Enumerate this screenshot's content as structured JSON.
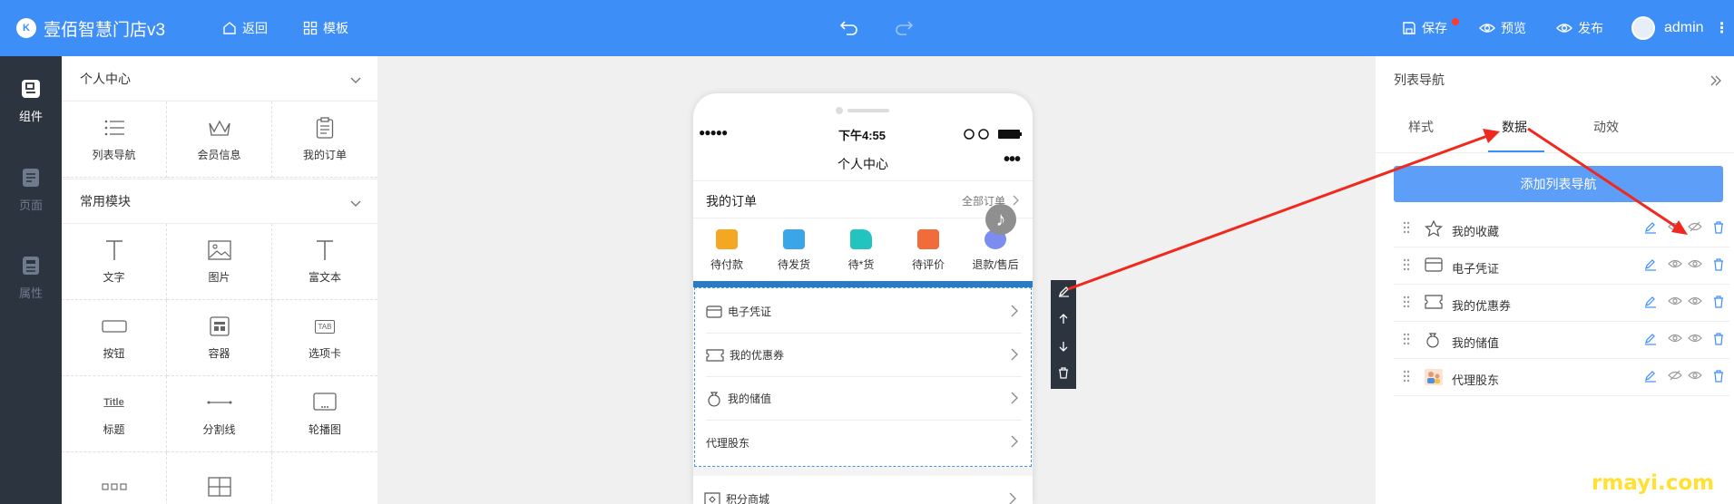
{
  "header": {
    "logo_text": "K",
    "app_title": "壹佰智慧门店v3",
    "back_label": "返回",
    "template_label": "模板",
    "save_label": "保存",
    "preview_label": "预览",
    "publish_label": "发布",
    "user_name": "admin"
  },
  "left_rail": {
    "components_label": "组件",
    "pages_label": "页面",
    "properties_label": "属性"
  },
  "component_panel": {
    "section1_title": "个人中心",
    "section1_items": [
      "列表导航",
      "会员信息",
      "我的订单"
    ],
    "section2_title": "常用模块",
    "section2_items": [
      "文字",
      "图片",
      "富文本",
      "按钮",
      "容器",
      "选项卡",
      "标题",
      "分割线",
      "轮播图"
    ],
    "title_icon_text": "Title",
    "tab_icon_text": "TAB"
  },
  "phone": {
    "signal": "●●●●●",
    "time": "下午4:55",
    "page_title": "个人中心",
    "more": "•••",
    "my_orders": "我的订单",
    "all_orders": "全部订单",
    "order_status": [
      "待付款",
      "待发货",
      "待*货",
      "待评价",
      "退款/售后"
    ],
    "music_glyph": "♪",
    "list_items": [
      "电子凭证",
      "我的优惠券",
      "我的储值",
      "代理股东"
    ],
    "bottom_item": "积分商城"
  },
  "properties_panel": {
    "title": "列表导航",
    "tabs": [
      "样式",
      "数据",
      "动效"
    ],
    "active_tab": "数据",
    "add_button_label": "添加列表导航",
    "nav_items": [
      "我的收藏",
      "电子凭证",
      "我的优惠券",
      "我的储值",
      "代理股东"
    ]
  },
  "watermark": "rmayi.com",
  "colors": {
    "primary": "#3e8ef7",
    "rail": "#2c3440",
    "annotation_arrow": "#f0281e",
    "watermark": "#ffe033"
  }
}
